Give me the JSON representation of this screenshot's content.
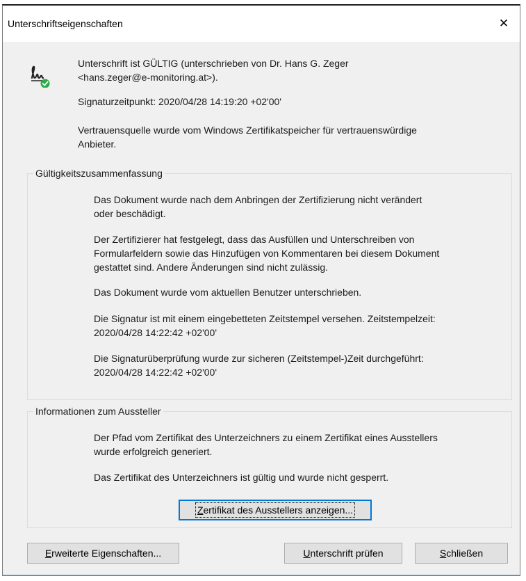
{
  "window": {
    "title": "Unterschriftseigenschaften",
    "close_symbol": "✕"
  },
  "signature": {
    "icon": "signature-valid-icon",
    "status_line1": "Unterschrift ist GÜLTIG (unterschrieben von Dr. Hans G. Zeger",
    "status_line2": "<hans.zeger@e-monitoring.at>).",
    "timestamp": "Signaturzeitpunkt:  2020/04/28 14:19:20 +02'00'",
    "trust_line1": "Vertrauensquelle wurde vom Windows Zertifikatspeicher für vertrauenswürdige",
    "trust_line2": "Anbieter."
  },
  "validity": {
    "legend": "Gültigkeitszusammenfassung",
    "lines": [
      "Das Dokument wurde nach dem Anbringen der Zertifizierung nicht verändert",
      "oder beschädigt.",
      "Der Zertifizierer hat festgelegt, dass das Ausfüllen und Unterschreiben von",
      "Formularfeldern sowie das Hinzufügen von Kommentaren bei diesem Dokument",
      "gestattet sind. Andere Änderungen sind nicht zulässig.",
      "Das Dokument wurde vom aktuellen Benutzer unterschrieben.",
      "Die Signatur ist mit einem eingebetteten Zeitstempel versehen. Zeitstempelzeit:",
      "2020/04/28 14:22:42 +02'00'",
      "Die Signaturüberprüfung wurde zur sicheren (Zeitstempel-)Zeit durchgeführt:",
      "2020/04/28 14:22:42 +02'00'"
    ]
  },
  "issuer": {
    "legend": "Informationen zum Aussteller",
    "lines": [
      "Der Pfad vom Zertifikat des Unterzeichners zu einem Zertifikat eines Ausstellers",
      "wurde erfolgreich generiert.",
      "Das Zertifikat des Unterzeichners ist gültig und wurde nicht gesperrt."
    ],
    "show_cert_button": "Zertifikat des Ausstellers anzeigen..."
  },
  "footer": {
    "advanced_button": "Erweiterte Eigenschaften...",
    "verify_button_u": "U",
    "verify_button_rest": "nterschrift prüfen",
    "close_button": "Schließen"
  }
}
